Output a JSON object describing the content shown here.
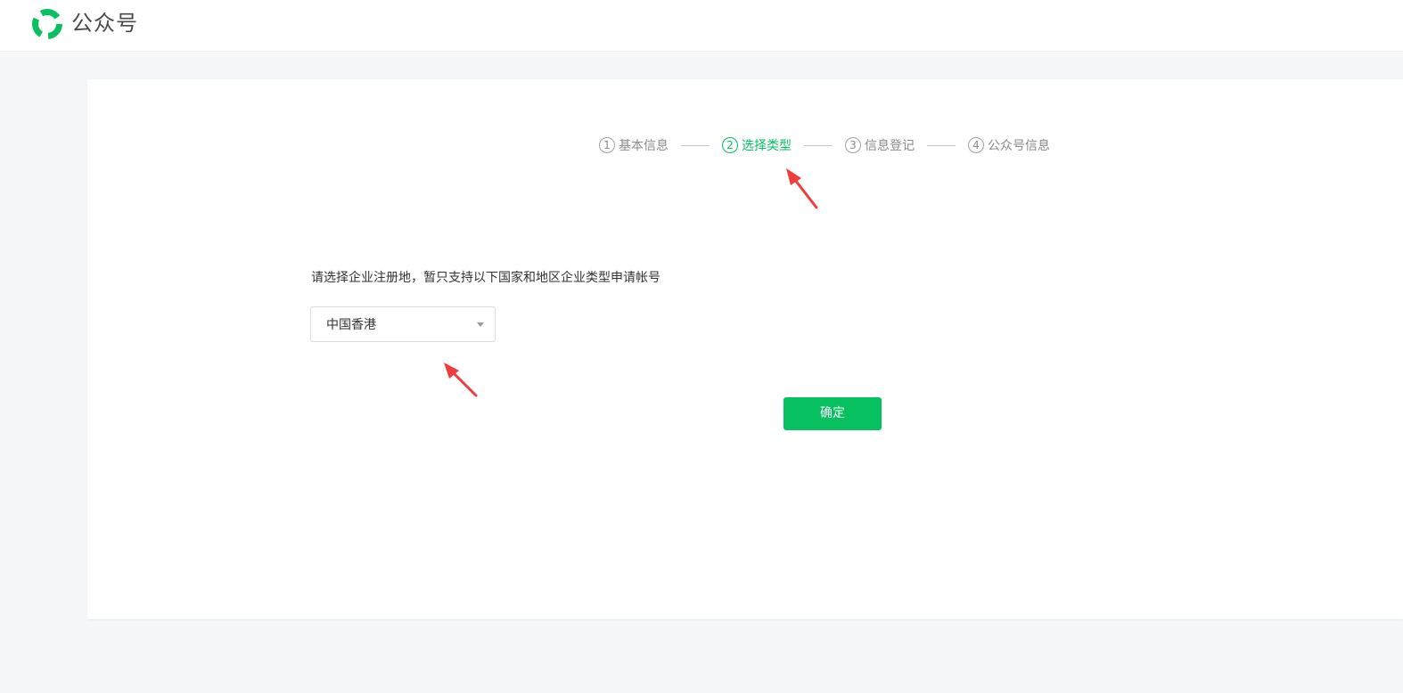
{
  "header": {
    "logo_icon": "wechat-official-account-logo-icon",
    "title": "公众号",
    "accent_color": "#07c160"
  },
  "steps": [
    {
      "number": "1",
      "label": "基本信息",
      "active": false
    },
    {
      "number": "2",
      "label": "选择类型",
      "active": true
    },
    {
      "number": "3",
      "label": "信息登记",
      "active": false
    },
    {
      "number": "4",
      "label": "公众号信息",
      "active": false
    }
  ],
  "main": {
    "prompt": "请选择企业注册地，暂只支持以下国家和地区企业类型申请帐号",
    "region_select": {
      "value": "中国香港",
      "caret_icon": "caret-down-icon"
    },
    "confirm_label": "确定"
  },
  "annotations": {
    "arrow_color": "#f03c3c"
  }
}
